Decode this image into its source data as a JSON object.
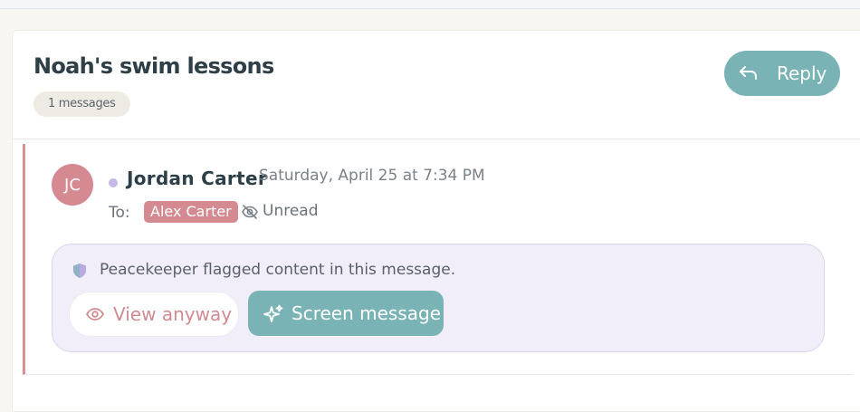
{
  "thread": {
    "title": "Noah's swim lessons",
    "message_count": "1 messages",
    "reply_label": "Reply"
  },
  "message": {
    "avatar_initials": "JC",
    "sender_name": "Jordan Carter",
    "timestamp": "Saturday, April 25 at 7:34 PM",
    "to_label": "To:",
    "recipient": "Alex Carter",
    "unread_label": "Unread",
    "flag_text": "Peacekeeper flagged content in this message.",
    "view_anyway_label": "View anyway",
    "screen_message_label": "Screen message"
  },
  "colors": {
    "accent_teal": "#79b3b5",
    "accent_rose": "#d58a92",
    "flag_panel_bg": "#f1eefa",
    "status_dot": "#c7b8ea"
  },
  "icons": {
    "reply": "reply-arrow-icon",
    "unread": "eye-off-icon",
    "shield": "shield-icon",
    "view": "eye-icon",
    "screen": "sparkle-icon"
  }
}
